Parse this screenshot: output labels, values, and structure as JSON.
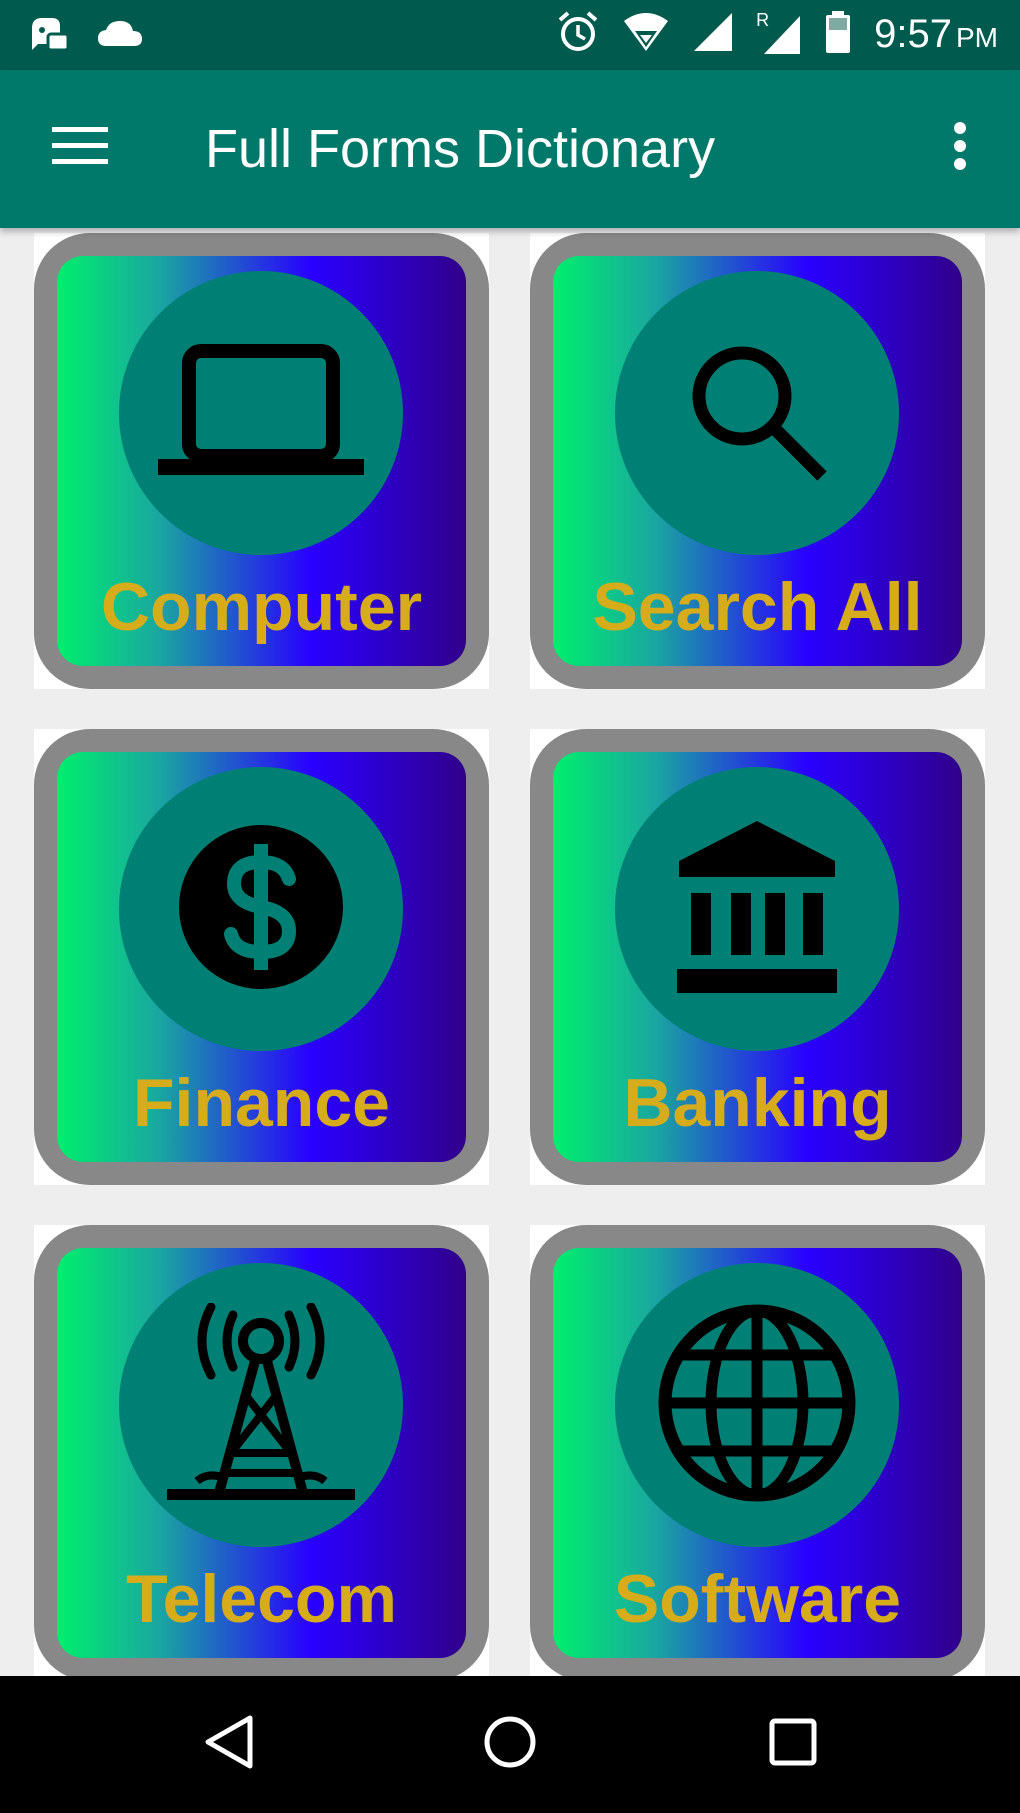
{
  "status_bar": {
    "time": "9:57",
    "ampm": "PM",
    "icons": [
      "notification-icon",
      "cloud-icon",
      "alarm-icon",
      "wifi-icon",
      "signal-icon",
      "roaming-signal-icon",
      "battery-icon"
    ],
    "roaming_label": "R"
  },
  "app_bar": {
    "title": "Full Forms Dictionary",
    "background": "#00796b",
    "menu_icon": "hamburger-menu-icon",
    "overflow_icon": "more-vert-icon"
  },
  "categories": [
    {
      "label": "Computer",
      "icon": "laptop-icon"
    },
    {
      "label": "Search All",
      "icon": "search-icon"
    },
    {
      "label": "Finance",
      "icon": "dollar-icon"
    },
    {
      "label": "Banking",
      "icon": "bank-icon"
    },
    {
      "label": "Telecom",
      "icon": "tower-icon"
    },
    {
      "label": "Software",
      "icon": "globe-icon"
    }
  ],
  "theme": {
    "label_color": "#d6ac1a",
    "circle_color": "#008075",
    "tile_border": "#888888",
    "gradient": [
      "#00ee6e",
      "#2a00ff",
      "#30008a"
    ]
  },
  "nav_bar": {
    "icons": [
      "back-icon",
      "home-icon",
      "recents-icon"
    ]
  }
}
